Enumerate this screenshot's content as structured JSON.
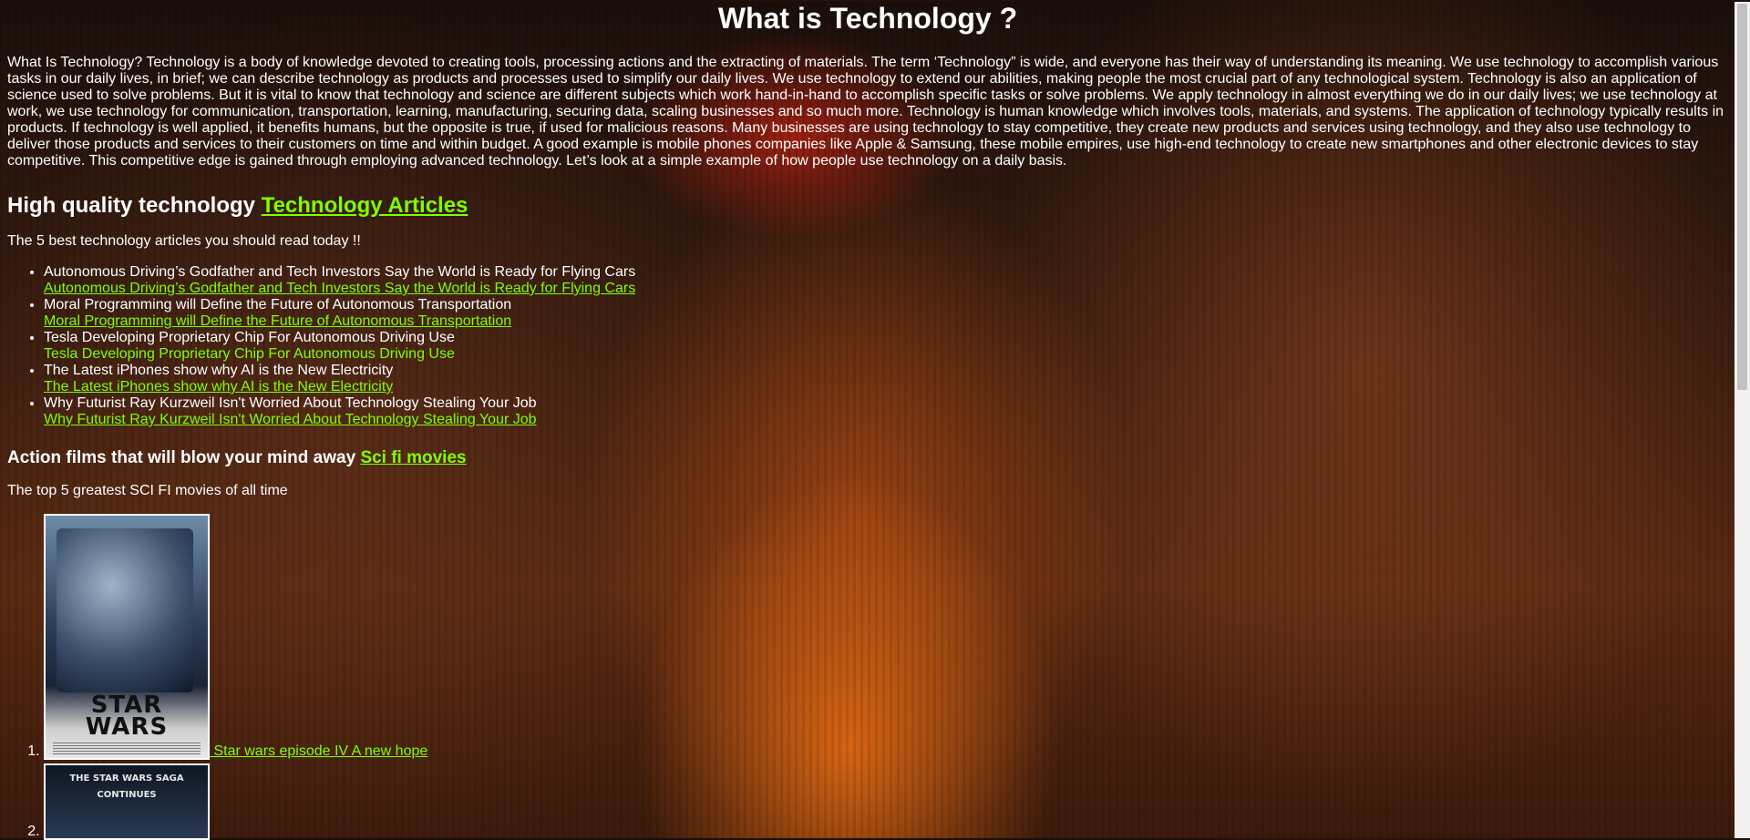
{
  "page": {
    "title": "What is Technology ?",
    "intro": "What Is Technology? Technology is a body of knowledge devoted to creating tools, processing actions and the extracting of materials. The term ‘Technology” is wide, and everyone has their way of understanding its meaning. We use technology to accomplish various tasks in our daily lives, in brief; we can describe technology as products and processes used to simplify our daily lives. We use technology to extend our abilities, making people the most crucial part of any technological system. Technology is also an application of science used to solve problems. But it is vital to know that technology and science are different subjects which work hand-in-hand to accomplish specific tasks or solve problems. We apply technology in almost everything we do in our daily lives; we use technology at work, we use technology for communication, transportation, learning, manufacturing, securing data, scaling businesses and so much more. Technology is human knowledge which involves tools, materials, and systems. The application of technology typically results in products. If technology is well applied, it benefits humans, but the opposite is true, if used for malicious reasons. Many businesses are using technology to stay competitive, they create new products and services using technology, and they also use technology to deliver those products and services to their customers on time and within budget. A good example is mobile phones companies like Apple & Samsung, these mobile empires, use high-end technology to create new smartphones and other electronic devices to stay competitive. This competitive edge is gained through employing advanced technology. Let’s look at a simple example of how people use technology on a daily basis."
  },
  "tech_section": {
    "heading": "High quality technology",
    "heading_link": "Technology Articles",
    "subtitle": "The 5 best technology articles you should read today !!",
    "articles": [
      {
        "title": "Autonomous Driving’s Godfather and Tech Investors Say the World is Ready for Flying Cars",
        "link": "Autonomous Driving’s Godfather and Tech Investors Say the World is Ready for Flying Cars",
        "underlined": true
      },
      {
        "title": "Moral Programming will Define the Future of Autonomous Transportation",
        "link": "Moral Programming will Define the Future of Autonomous Transportation",
        "underlined": true
      },
      {
        "title": "Tesla Developing Proprietary Chip For Autonomous Driving Use",
        "link": "Tesla Developing Proprietary Chip For Autonomous Driving Use",
        "underlined": false
      },
      {
        "title": "The Latest iPhones show why AI is the New Electricity",
        "link": "The Latest iPhones show why AI is the New Electricity",
        "underlined": true
      },
      {
        "title": "Why Futurist Ray Kurzweil Isn't Worried About Technology Stealing Your Job",
        "link": "Why Futurist Ray Kurzweil Isn't Worried About Technology Stealing Your Job",
        "underlined": true
      }
    ]
  },
  "movies_section": {
    "heading": "Action films that will blow your mind away",
    "heading_link": "Sci fi movies",
    "subtitle": "The top 5 greatest SCI FI movies of all time",
    "movies": [
      {
        "poster_logo": "STAR WARS",
        "link": " Star wars episode IV A new hope"
      },
      {
        "poster_tagline": "THE STAR WARS SAGA CONTINUES"
      }
    ]
  },
  "colors": {
    "link": "#7fff00",
    "text": "#ffffff"
  }
}
